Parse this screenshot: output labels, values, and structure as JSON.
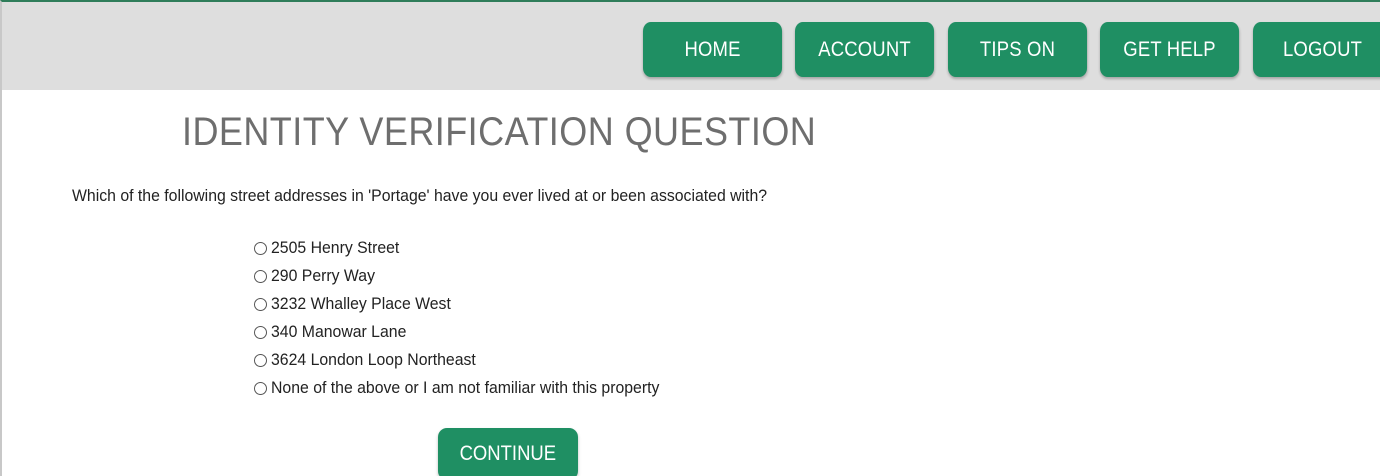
{
  "nav": {
    "home": "HOME",
    "account": "ACCOUNT",
    "tips": "TIPS ON",
    "help": "GET HELP",
    "logout": "LOGOUT"
  },
  "page": {
    "title": "IDENTITY VERIFICATION QUESTION",
    "question": "Which of the following street addresses in 'Portage' have you ever lived at or been associated with?"
  },
  "options": [
    {
      "label": "2505 Henry Street",
      "selected": false
    },
    {
      "label": "290 Perry Way",
      "selected": false
    },
    {
      "label": "3232 Whalley Place West",
      "selected": false
    },
    {
      "label": "340 Manowar Lane",
      "selected": false
    },
    {
      "label": "3624 London Loop Northeast",
      "selected": false
    },
    {
      "label": "None of the above or I am not familiar with this property",
      "selected": false
    }
  ],
  "actions": {
    "continue": "CONTINUE"
  },
  "colors": {
    "accent": "#1f8f63",
    "topbar": "#dedede",
    "title": "#6e6e6e"
  }
}
